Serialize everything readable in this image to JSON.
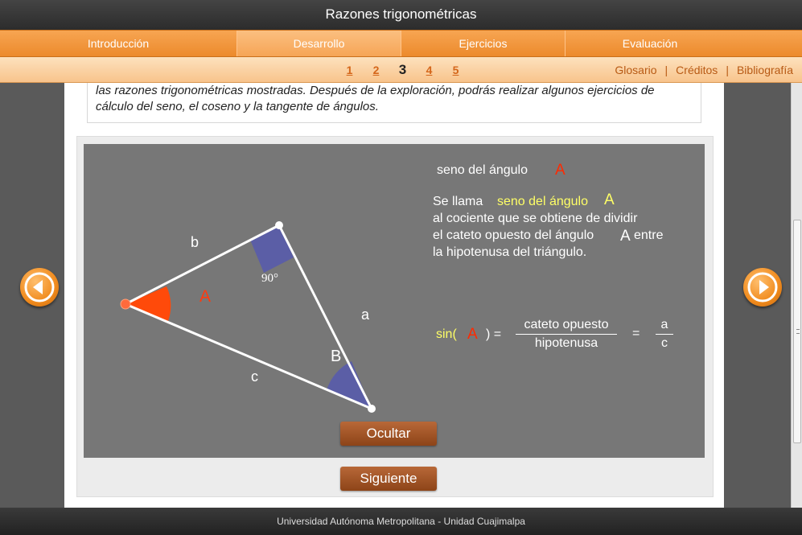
{
  "app": {
    "title": "Razones trigonométricas"
  },
  "main_nav": {
    "tabs": [
      {
        "label": "Introducción"
      },
      {
        "label": "Desarrollo"
      },
      {
        "label": "Ejercicios"
      },
      {
        "label": "Evaluación"
      }
    ],
    "active": "Desarrollo"
  },
  "sub_nav": {
    "pages": [
      "1",
      "2",
      "3",
      "4",
      "5"
    ],
    "current_page": "3",
    "links": [
      "Glosario",
      "Créditos",
      "Bibliografía"
    ],
    "separator": "|"
  },
  "intro_text": "las razones trigonométricas mostradas. Después de la exploración, podrás realizar algunos ejercicios de cálculo del seno, el coseno y la tangente de ángulos.",
  "scene": {
    "heading": "seno del ángulo",
    "heading_angle": "A",
    "def_prefix": "Se llama",
    "def_highlight": "seno del ángulo",
    "def_angle": "A",
    "def_line2": "al cociente que se obtiene de dividir",
    "def_line3a": "el cateto opuesto del ángulo",
    "def_line3_angle": "A",
    "def_line3b": "entre",
    "def_line4": "la hipotenusa del triángulo.",
    "formula": {
      "func": "sin(",
      "angle": "A",
      "close": ") =",
      "numerator": "cateto opuesto",
      "denominator": "hipotenusa",
      "equals": "=",
      "num2": "a",
      "den2": "c"
    },
    "triangle": {
      "side_b": "b",
      "side_a": "a",
      "side_c": "c",
      "angle_A": "A",
      "angle_B": "B",
      "right_angle": "90°"
    },
    "hide_button": "Ocultar"
  },
  "next_button": "Siguiente",
  "footer": "Universidad Autónoma Metropolitana - Unidad Cuajimalpa",
  "colors": {
    "accent_orange": "#ec8a2c",
    "angle_red": "#ff2a00",
    "highlight_yellow": "#ffff66",
    "right_angle_fill": "#5b5ea6"
  }
}
